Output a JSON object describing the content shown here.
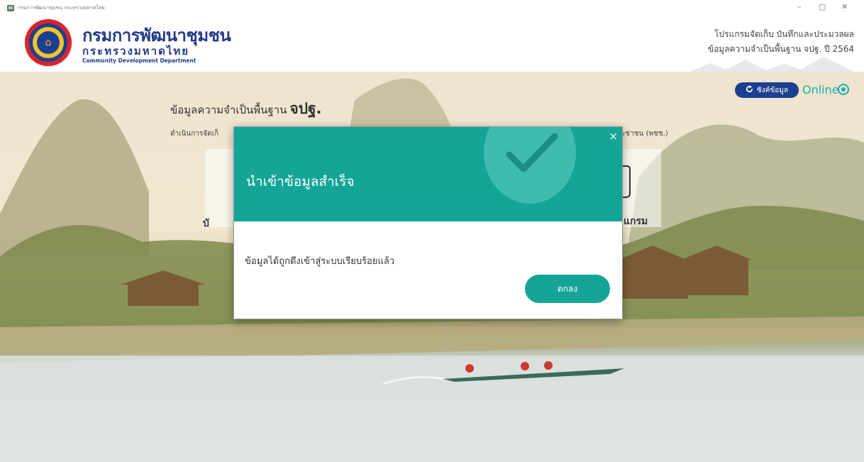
{
  "window": {
    "title": "กรมการพัฒนาชุมชน กระทรวงมหาดไทย",
    "controls": {
      "minimize": "–",
      "maximize": "▢",
      "close": "✕"
    }
  },
  "header": {
    "org_name_th": "กรมการพัฒนาชุมชน",
    "ministry_th": "กระทรวงมหาดไทย",
    "org_name_en": "Community Development Department",
    "program_line1": "โปรแกรมจัดเก็บ บันทึกและประมวลผล",
    "program_line2": "ข้อมูลความจำเป็นพื้นฐาน จปฐ. ปี 2564"
  },
  "main": {
    "title_prefix": "ข้อมูลความจำเป็นพื้นฐาน",
    "title_bold": "จปฐ.",
    "subtitle_left": "ดำเนินการจัดเก็",
    "subtitle_right": "ะชาชน (พชช.)",
    "card_left_label": "บั",
    "card_right_label": "แกรม"
  },
  "status": {
    "sync_label": "ซิงค์ข้อมูล",
    "sync_icon": "refresh-icon",
    "online_label": "Online",
    "accent_color": "#15b3a6",
    "sync_bg": "#1c3f8f"
  },
  "dialog": {
    "title": "นำเข้าข้อมูลสำเร็จ",
    "message": "ข้อมูลได้ถูกดึงเข้าสู่ระบบเรียบร้อยแล้ว",
    "ok_label": "ตกลง",
    "close_symbol": "×",
    "header_color": "#14a597"
  }
}
